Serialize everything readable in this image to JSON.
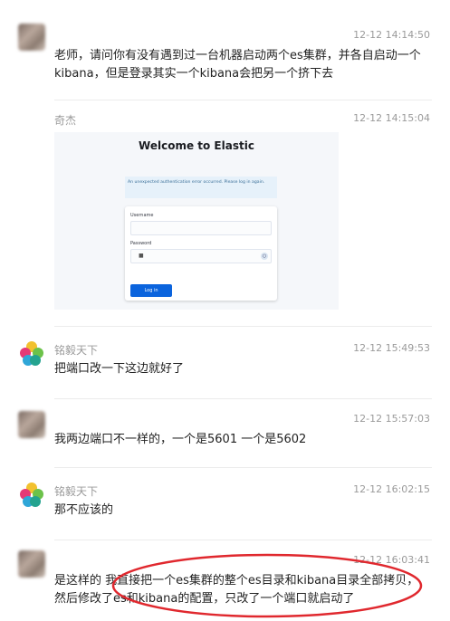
{
  "messages": [
    {
      "name": "",
      "time": "12-12 14:14:50",
      "text": "老师，请问你有没有遇到过一台机器启动两个es集群，并各自启动一个kibana，但是登录其实一个kibana会把另一个挤下去",
      "avatar": "user-avatar"
    },
    {
      "name": "奇杰",
      "time": "12-12 14:15:04",
      "avatar": "user-avatar",
      "screenshot": {
        "title": "Welcome to Elastic",
        "alert": "An unexpected authentication error occurred. Please log in again.",
        "username_label": "Username",
        "password_label": "Password",
        "login_button": "Log in"
      }
    },
    {
      "name": "铭毅天下",
      "time": "12-12 15:49:53",
      "text": "把端口改一下这边就好了",
      "avatar": "flower-avatar"
    },
    {
      "name": "",
      "time": "12-12 15:57:03",
      "text": "我两边端口不一样的，一个是5601 一个是5602",
      "avatar": "user-avatar"
    },
    {
      "name": "铭毅天下",
      "time": "12-12 16:02:15",
      "text": "那不应该的",
      "avatar": "flower-avatar"
    },
    {
      "name": "",
      "time": "12-12 16:03:41",
      "text": "是这样的   我直接把一个es集群的整个es目录和kibana目录全部拷贝，然后修改了es和kibana的配置，只改了一个端口就启动了",
      "avatar": "user-avatar"
    }
  ],
  "colors": {
    "annotation": "#e0282e",
    "accent_button": "#0b64dd"
  }
}
